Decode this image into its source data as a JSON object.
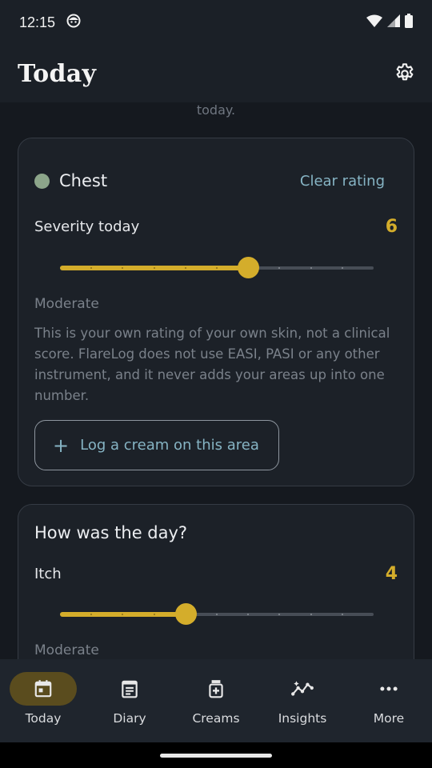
{
  "status_bar": {
    "time": "12:15"
  },
  "app_bar": {
    "title": "Today",
    "settings_icon": "gear-icon"
  },
  "top_faded_text": "today.",
  "area_card": {
    "area_name": "Chest",
    "area_color": "#8ca58a",
    "clear_label": "Clear rating",
    "severity_label": "Severity today",
    "severity_value": "6",
    "slider": {
      "value": 6,
      "min": 0,
      "max": 10,
      "steps": 10
    },
    "level_text": "Moderate",
    "note": "This is your own rating of your own skin, not a clinical score. FlareLog does not use EASI, PASI or any other instrument, and it never adds your areas up into one number.",
    "log_button_label": "Log a cream on this area",
    "log_button_icon": "plus-icon"
  },
  "day_card": {
    "title": "How was the day?",
    "itch_label": "Itch",
    "itch_value": "4",
    "slider": {
      "value": 4,
      "min": 0,
      "max": 10,
      "steps": 10
    },
    "level_text": "Moderate"
  },
  "nav": {
    "items": [
      {
        "label": "Today",
        "icon": "calendar-today-icon",
        "active": true
      },
      {
        "label": "Diary",
        "icon": "diary-icon",
        "active": false
      },
      {
        "label": "Creams",
        "icon": "cream-tube-icon",
        "active": false
      },
      {
        "label": "Insights",
        "icon": "insights-icon",
        "active": false
      },
      {
        "label": "More",
        "icon": "more-dots-icon",
        "active": false
      }
    ]
  },
  "colors": {
    "accent": "#d4ad2b",
    "link": "#86b4c4",
    "background": "#15191f",
    "card": "#1c2128",
    "nav_active": "#5a4c1e"
  }
}
